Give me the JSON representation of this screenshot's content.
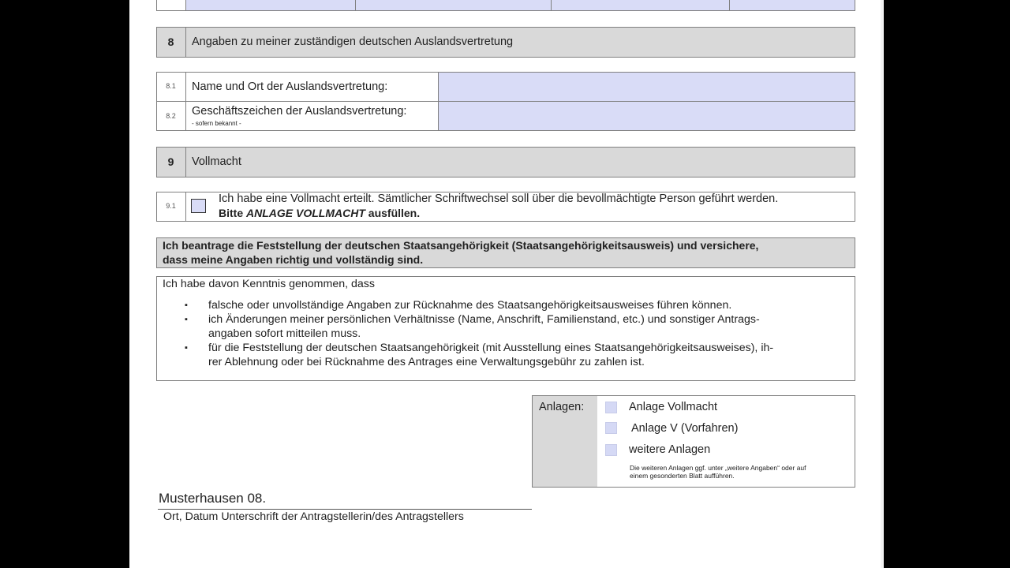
{
  "section8": {
    "number": "8",
    "title": "Angaben zu meiner zuständigen deutschen Auslandsvertretung",
    "row1": {
      "number": "8.1",
      "label": "Name und Ort der Auslandsvertretung:",
      "value": ""
    },
    "row2": {
      "number": "8.2",
      "label": "Geschäftszeichen der Auslandsvertretung:",
      "sublabel": "- sofern bekannt -",
      "value": ""
    }
  },
  "section9": {
    "number": "9",
    "title": "Vollmacht",
    "row1": {
      "number": "9.1",
      "line1": "Ich habe eine Vollmacht erteilt. Sämtlicher Schriftwechsel soll über die bevollmächtigte Person geführt werden.",
      "line2_pre": "Bitte ",
      "line2_italic": "ANLAGE VOLLMACHT",
      "line2_post": " ausfüllen."
    }
  },
  "declaration": {
    "line1": "Ich beantrage die Feststellung der deutschen Staatsangehörigkeit (Staatsangehörigkeitsausweis) und versichere,",
    "line2": "dass meine Angaben richtig und vollständig sind."
  },
  "notice": {
    "intro": "Ich habe davon Kenntnis genommen, dass",
    "items": [
      [
        "falsche oder unvollständige Angaben zur Rücknahme des Staatsangehörigkeitsausweises führen können."
      ],
      [
        "ich Änderungen meiner persönlichen Verhältnisse (Name, Anschrift, Familienstand, etc.) und sonstiger Antrags-",
        "angaben sofort mitteilen muss."
      ],
      [
        "für die Feststellung der deutschen Staatsangehörigkeit (mit Ausstellung eines Staatsangehörigkeitsausweises), ih-",
        "rer Ablehnung oder bei Rücknahme des Antrages eine Verwaltungsgebühr zu zahlen ist."
      ]
    ]
  },
  "attachments": {
    "label": "Anlagen:",
    "items": [
      "Anlage Vollmacht",
      "Anlage V (Vorfahren)",
      "weitere Anlagen"
    ],
    "note1": "Die weiteren Anlagen ggf. unter „weitere Angaben“ oder auf",
    "note2": "einem gesonderten Blatt aufführen."
  },
  "signature": {
    "value": "Musterhausen 08.",
    "caption": "Ort, Datum Unterschrift der Antragstellerin/des Antragstellers"
  }
}
